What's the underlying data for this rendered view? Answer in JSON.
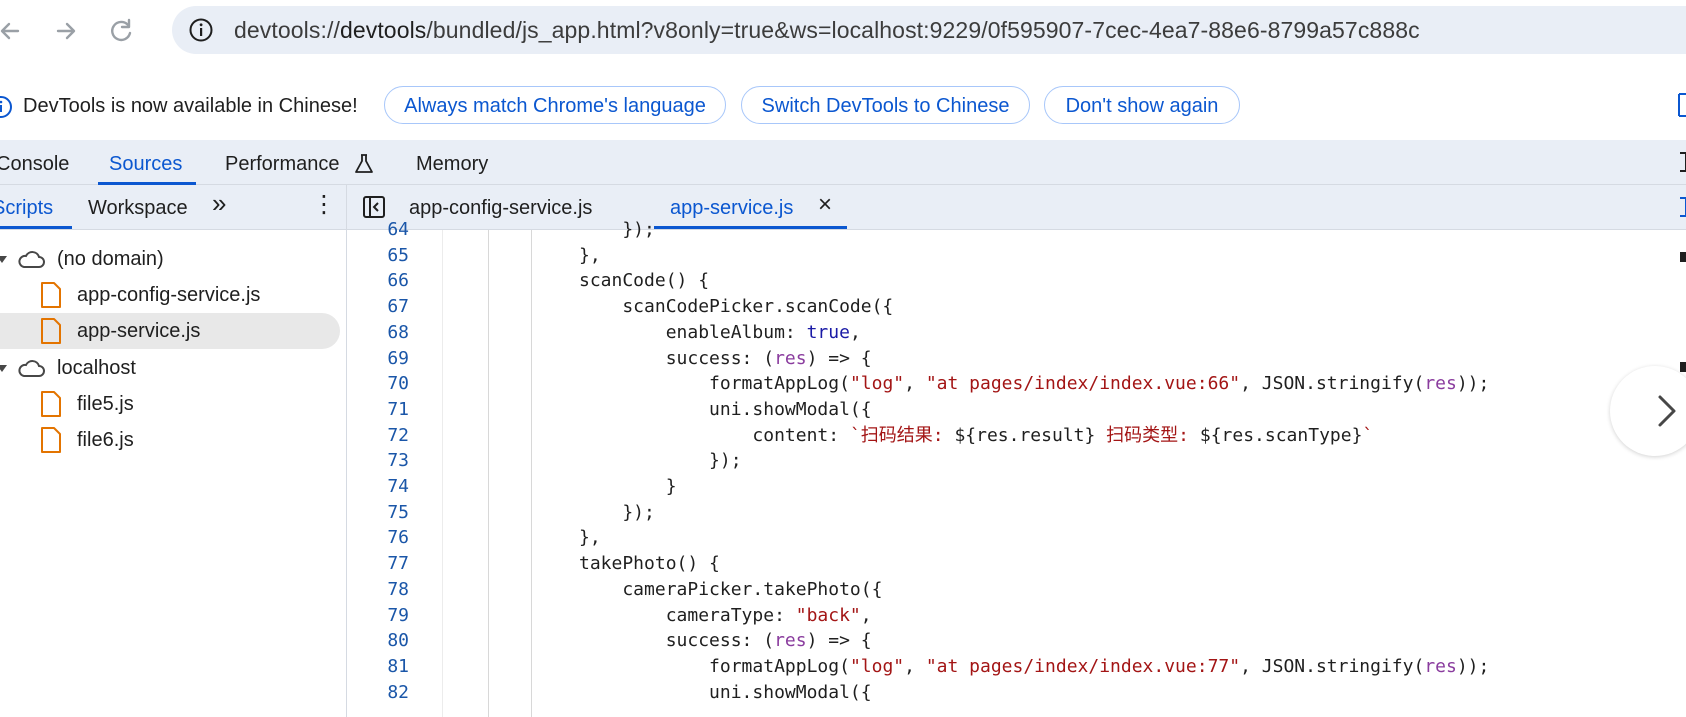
{
  "browser": {
    "url_prefix": "devtools://",
    "url_host": "devtools",
    "url_rest": "/bundled/js_app.html?v8only=true&ws=localhost:9229/0f595907-7cec-4ea7-88e6-8799a57c888c",
    "icons": {
      "back": "back-arrow-icon",
      "forward": "forward-arrow-icon",
      "reload": "reload-icon",
      "info": "info-icon"
    }
  },
  "infobar": {
    "message": "DevTools is now available in Chinese!",
    "buttons": [
      "Always match Chrome's language",
      "Switch DevTools to Chinese",
      "Don't show again"
    ]
  },
  "main_tabs": [
    "Console",
    "Sources",
    "Performance",
    "Memory"
  ],
  "active_main_tab": "Sources",
  "navigator": {
    "tabs": [
      "Scripts",
      "Workspace"
    ],
    "more_label": "»",
    "menu_label": "⋮",
    "tree": [
      {
        "label": "(no domain)",
        "type": "domain",
        "files": [
          "app-config-service.js",
          "app-service.js"
        ]
      },
      {
        "label": "localhost",
        "type": "domain",
        "files": [
          "file5.js",
          "file6.js"
        ]
      }
    ],
    "selected_file": "app-service.js"
  },
  "editor": {
    "tabs": [
      "app-config-service.js",
      "app-service.js"
    ],
    "active_tab": "app-service.js",
    "close_label": "×",
    "lines": [
      {
        "n": "64",
        "t": "    });"
      },
      {
        "n": "65",
        "t": "},",
        "i": 0
      },
      {
        "n": "66",
        "t": "scanCode() {"
      },
      {
        "n": "67",
        "t": "    scanCodePicker.scanCode({"
      },
      {
        "n": "68",
        "t": "        enableAlbum: true,"
      },
      {
        "n": "69",
        "t": "        success: (res) => {"
      },
      {
        "n": "70",
        "t": "            formatAppLog(\"log\", \"at pages/index/index.vue:66\", JSON.stringify(res));"
      },
      {
        "n": "71",
        "t": "            uni.showModal({"
      },
      {
        "n": "72",
        "t": "                content: `扫码结果: ${res.result} 扫码类型: ${res.scanType}`"
      },
      {
        "n": "73",
        "t": "            });"
      },
      {
        "n": "74",
        "t": "        }"
      },
      {
        "n": "75",
        "t": "    });"
      },
      {
        "n": "76",
        "t": "},"
      },
      {
        "n": "77",
        "t": "takePhoto() {"
      },
      {
        "n": "78",
        "t": "    cameraPicker.takePhoto({"
      },
      {
        "n": "79",
        "t": "        cameraType: \"back\","
      },
      {
        "n": "80",
        "t": "        success: (res) => {"
      },
      {
        "n": "81",
        "t": "            formatAppLog(\"log\", \"at pages/index/index.vue:77\", JSON.stringify(res));"
      },
      {
        "n": "82",
        "t": "            uni.showModal({"
      }
    ]
  },
  "colors": {
    "accent": "#0b57d0",
    "line_number": "#1a56a8",
    "string": "#a31515",
    "keyword": "#1a1aa6",
    "file_icon": "#e37400"
  }
}
